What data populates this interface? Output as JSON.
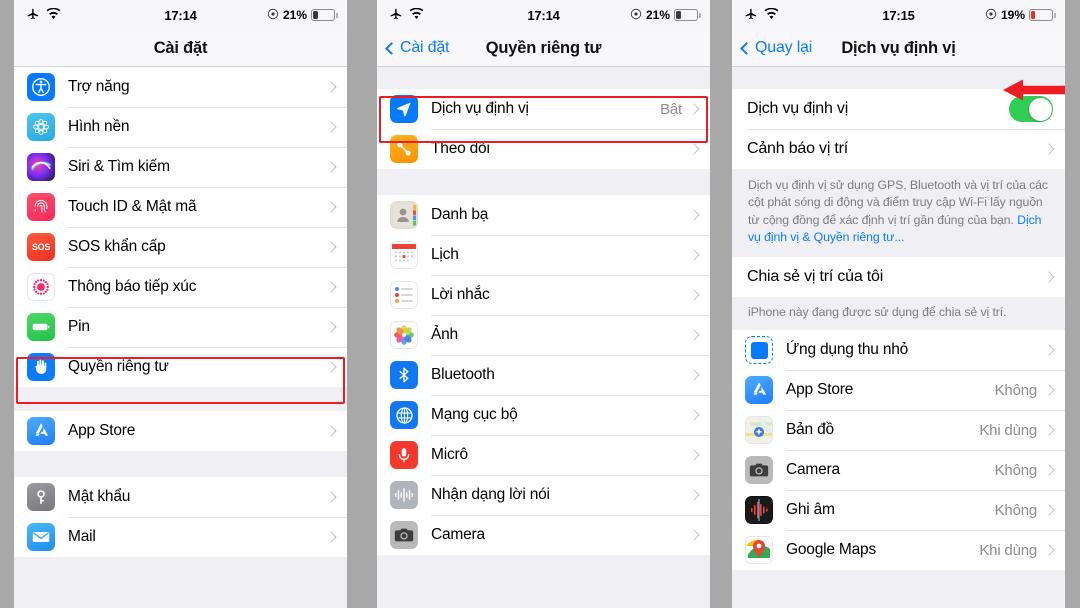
{
  "panels": {
    "left": {
      "status": {
        "airplane_icon": "airplane-icon",
        "wifi_icon": "wifi-icon",
        "time": "17:14",
        "alarm_icon": "alarm-icon",
        "battery_pct": "21%",
        "battery_level": 21,
        "battery_color": "#3a3a3a"
      },
      "nav": {
        "title": "Cài đặt"
      },
      "groups": [
        {
          "rows": [
            {
              "label": "Trợ năng",
              "icon": "accessibility-icon"
            },
            {
              "label": "Hình nền",
              "icon": "wallpaper-icon"
            },
            {
              "label": "Siri & Tìm kiếm",
              "icon": "siri-icon"
            },
            {
              "label": "Touch ID & Mật mã",
              "icon": "touchid-icon"
            },
            {
              "label": "SOS khẩn cấp",
              "icon": "sos-icon"
            },
            {
              "label": "Thông báo tiếp xúc",
              "icon": "exposure-notification-icon"
            },
            {
              "label": "Pin",
              "icon": "battery-icon"
            },
            {
              "label": "Quyền riêng tư",
              "icon": "privacy-hand-icon",
              "highlighted": true
            }
          ]
        },
        {
          "rows": [
            {
              "label": "App Store",
              "icon": "app-store-icon"
            }
          ]
        },
        {
          "rows": [
            {
              "label": "Mật khẩu",
              "icon": "password-key-icon"
            },
            {
              "label": "Mail",
              "icon": "mail-icon"
            }
          ]
        }
      ]
    },
    "middle": {
      "status": {
        "time": "17:14",
        "battery_pct": "21%",
        "battery_level": 21,
        "battery_color": "#3a3a3a"
      },
      "nav": {
        "back_label": "Cài đặt",
        "title": "Quyền riêng tư"
      },
      "groups": [
        {
          "rows": [
            {
              "label": "Dịch vụ định vị",
              "value": "Bật",
              "icon": "location-services-icon",
              "highlighted": true
            },
            {
              "label": "Theo dõi",
              "icon": "tracking-icon"
            }
          ]
        },
        {
          "rows": [
            {
              "label": "Danh bạ",
              "icon": "contacts-icon"
            },
            {
              "label": "Lịch",
              "icon": "calendar-icon"
            },
            {
              "label": "Lời nhắc",
              "icon": "reminders-icon"
            },
            {
              "label": "Ảnh",
              "icon": "photos-icon"
            },
            {
              "label": "Bluetooth",
              "icon": "bluetooth-icon"
            },
            {
              "label": "Mạng cục bộ",
              "icon": "local-network-icon"
            },
            {
              "label": "Micrô",
              "icon": "microphone-icon"
            },
            {
              "label": "Nhận dạng lời nói",
              "icon": "speech-recognition-icon"
            },
            {
              "label": "Camera",
              "icon": "camera-icon"
            }
          ]
        }
      ]
    },
    "right": {
      "status": {
        "time": "17:15",
        "battery_pct": "19%",
        "battery_level": 19,
        "battery_color": "#f03027"
      },
      "nav": {
        "back_label": "Quay lại",
        "title": "Dịch vụ định vị"
      },
      "toggle_row": {
        "label": "Dịch vụ định vị",
        "state": "on"
      },
      "alert_row": {
        "label": "Cảnh báo vị trí"
      },
      "footnote1": {
        "text": "Dịch vụ định vị sử dụng GPS, Bluetooth và vị trí của các cột phát sóng di động và điểm truy cập Wi-Fi lấy nguồn từ cộng đồng để xác định vị trí gần đúng của bạn. ",
        "link": "Dịch vụ định vị & Quyền riêng tư..."
      },
      "share_row": {
        "label": "Chia sẻ vị trí của tôi"
      },
      "footnote2": {
        "text": "iPhone này đang được sử dụng để chia sẻ vị trí."
      },
      "apps": [
        {
          "label": "Ứng dụng thu nhỏ",
          "value": "",
          "icon": "mini-app-icon"
        },
        {
          "label": "App Store",
          "value": "Không",
          "icon": "app-store-icon"
        },
        {
          "label": "Bản đồ",
          "value": "Khi dùng",
          "icon": "maps-icon"
        },
        {
          "label": "Camera",
          "value": "Không",
          "icon": "camera-icon"
        },
        {
          "label": "Ghi âm",
          "value": "Không",
          "icon": "voice-memos-icon"
        },
        {
          "label": "Google Maps",
          "value": "Khi dùng",
          "icon": "google-maps-icon"
        }
      ]
    }
  },
  "annotations": {
    "arrow": {
      "name": "red-arrow-pointing-left",
      "color": "#ee1c25"
    },
    "highlight_color": "#ee1c25"
  }
}
